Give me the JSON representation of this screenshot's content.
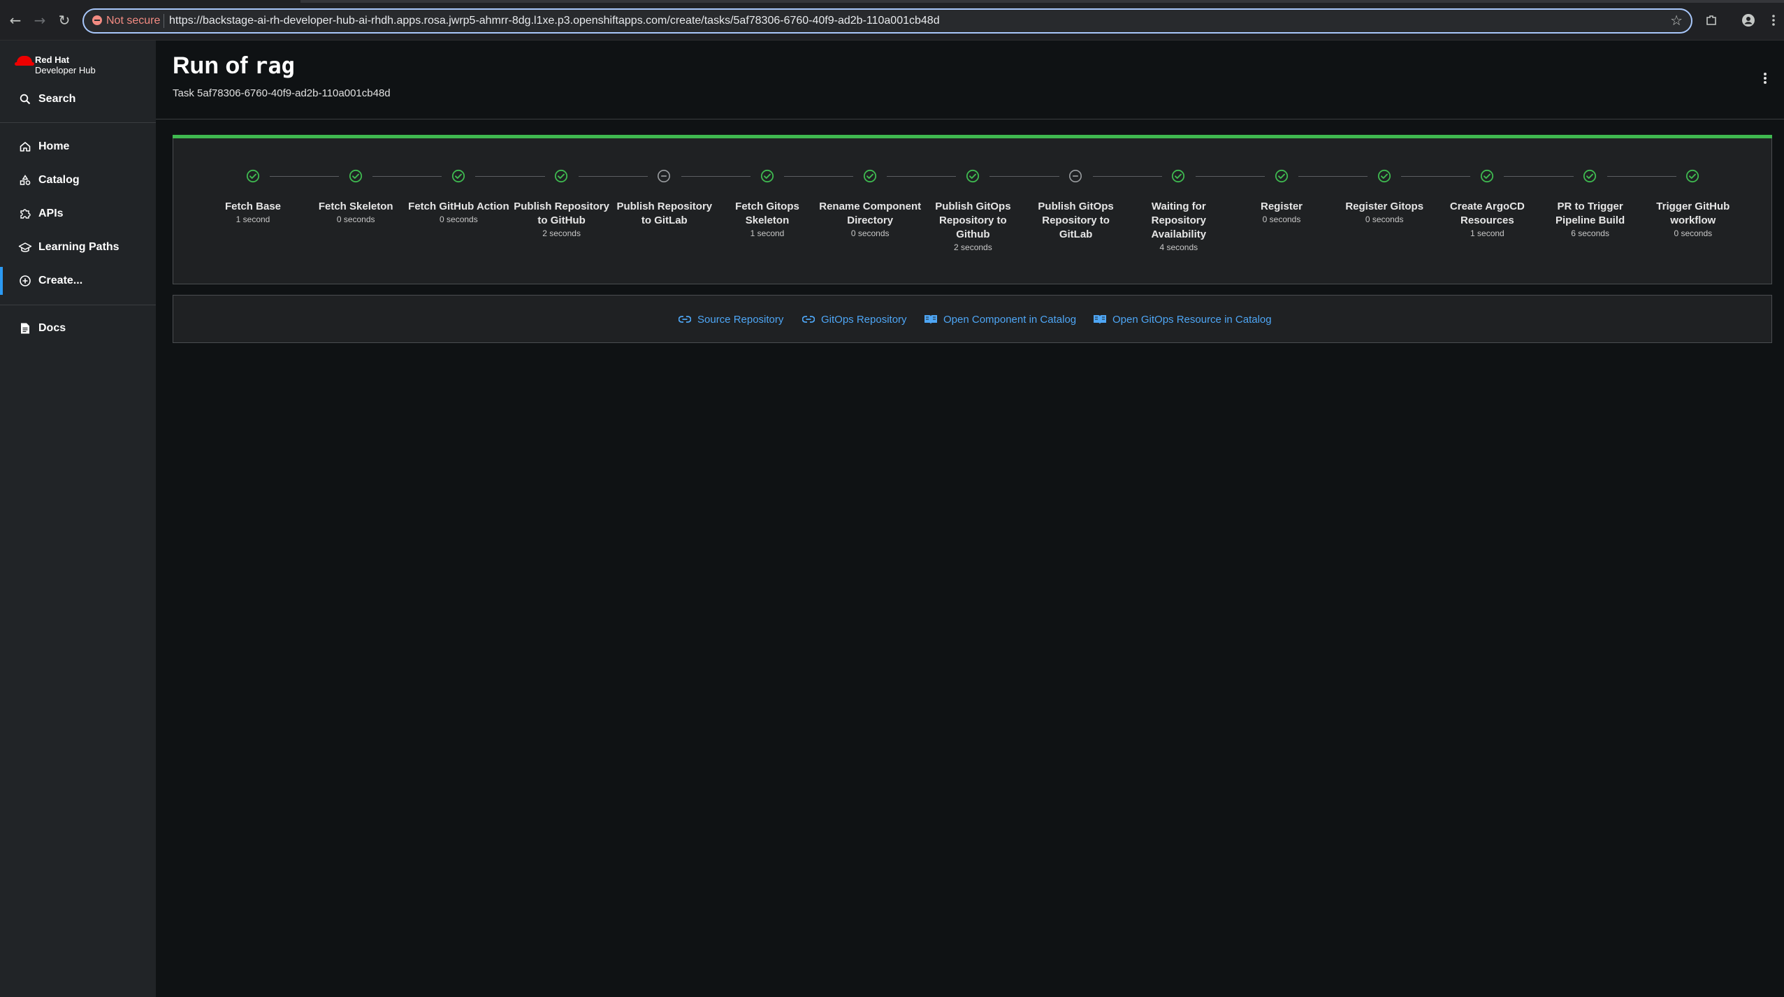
{
  "browser": {
    "security_label": "Not secure",
    "url": "https://backstage-ai-rh-developer-hub-ai-rhdh.apps.rosa.jwrp5-ahmrr-8dg.l1xe.p3.openshiftapps.com/create/tasks/5af78306-6760-40f9-ad2b-110a001cb48d"
  },
  "sidebar": {
    "logo_line1": "Red Hat",
    "logo_line2": "Developer Hub",
    "search_label": "Search",
    "items": [
      {
        "label": "Home",
        "icon": "home-icon"
      },
      {
        "label": "Catalog",
        "icon": "catalog-icon"
      },
      {
        "label": "APIs",
        "icon": "puzzle-icon"
      },
      {
        "label": "Learning Paths",
        "icon": "graduation-cap-icon"
      },
      {
        "label": "Create...",
        "icon": "add-circle-icon",
        "active": true
      }
    ],
    "docs_label": "Docs"
  },
  "header": {
    "title_prefix": "Run of",
    "title_code": "rag",
    "subtitle": "Task 5af78306-6760-40f9-ad2b-110a001cb48d"
  },
  "steps": [
    {
      "name": "Fetch Base",
      "duration": "1 second",
      "status": "completed"
    },
    {
      "name": "Fetch Skeleton",
      "duration": "0 seconds",
      "status": "completed"
    },
    {
      "name": "Fetch GitHub Action",
      "duration": "0 seconds",
      "status": "completed"
    },
    {
      "name": "Publish Repository to GitHub",
      "duration": "2 seconds",
      "status": "completed"
    },
    {
      "name": "Publish Repository to GitLab",
      "duration": "",
      "status": "skipped"
    },
    {
      "name": "Fetch Gitops Skeleton",
      "duration": "1 second",
      "status": "completed"
    },
    {
      "name": "Rename Component Directory",
      "duration": "0 seconds",
      "status": "completed"
    },
    {
      "name": "Publish GitOps Repository to Github",
      "duration": "2 seconds",
      "status": "completed"
    },
    {
      "name": "Publish GitOps Repository to GitLab",
      "duration": "",
      "status": "skipped"
    },
    {
      "name": "Waiting for Repository Availability",
      "duration": "4 seconds",
      "status": "completed"
    },
    {
      "name": "Register",
      "duration": "0 seconds",
      "status": "completed"
    },
    {
      "name": "Register Gitops",
      "duration": "0 seconds",
      "status": "completed"
    },
    {
      "name": "Create ArgoCD Resources",
      "duration": "1 second",
      "status": "completed"
    },
    {
      "name": "PR to Trigger Pipeline Build",
      "duration": "6 seconds",
      "status": "completed"
    },
    {
      "name": "Trigger GitHub workflow",
      "duration": "0 seconds",
      "status": "completed"
    }
  ],
  "links": [
    {
      "label": "Source Repository",
      "icon": "link-icon"
    },
    {
      "label": "GitOps Repository",
      "icon": "link-icon"
    },
    {
      "label": "Open Component in Catalog",
      "icon": "catalog-book-icon"
    },
    {
      "label": "Open GitOps Resource in Catalog",
      "icon": "catalog-book-icon"
    }
  ],
  "colors": {
    "success": "#3fb950",
    "link": "#4ea6f5",
    "accent": "#2b9af3",
    "brand_red": "#ee0000"
  }
}
